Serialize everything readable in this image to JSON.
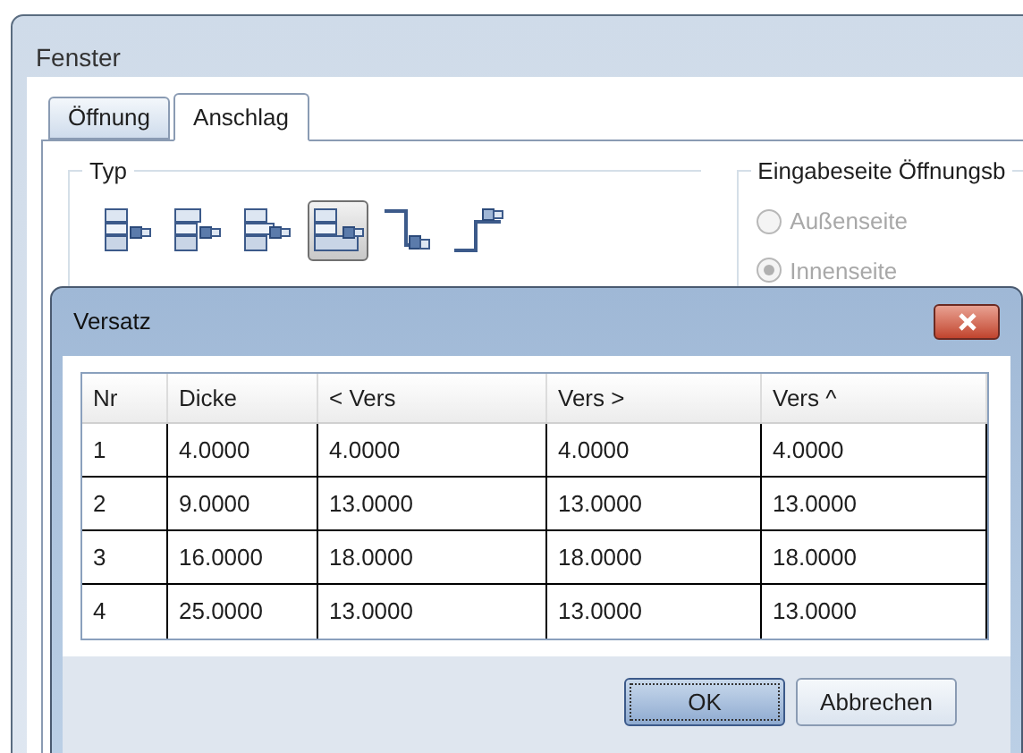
{
  "window": {
    "title": "Fenster"
  },
  "tabs": [
    {
      "label": "Öffnung",
      "selected": false
    },
    {
      "label": "Anschlag",
      "selected": true
    }
  ],
  "type_group": {
    "title": "Typ",
    "options": [
      {
        "selected": false
      },
      {
        "selected": false
      },
      {
        "selected": false
      },
      {
        "selected": true
      },
      {
        "selected": false
      },
      {
        "selected": false
      }
    ]
  },
  "input_side_group": {
    "title": "Eingabeseite Öffnungsb",
    "radios": [
      {
        "label": "Außenseite",
        "selected": false,
        "disabled": true
      },
      {
        "label": "Innenseite",
        "selected": true,
        "disabled": true
      }
    ]
  },
  "dialog": {
    "title": "Versatz",
    "table": {
      "columns": [
        "Nr",
        "Dicke",
        "< Vers",
        "Vers >",
        "Vers ^"
      ],
      "rows": [
        [
          "1",
          "4.0000",
          "4.0000",
          "4.0000",
          "4.0000"
        ],
        [
          "2",
          "9.0000",
          "13.0000",
          "13.0000",
          "13.0000"
        ],
        [
          "3",
          "16.0000",
          "18.0000",
          "18.0000",
          "18.0000"
        ],
        [
          "4",
          "25.0000",
          "13.0000",
          "13.0000",
          "13.0000"
        ]
      ]
    },
    "buttons": [
      {
        "label": "OK",
        "default": true
      },
      {
        "label": "Abbrechen",
        "default": false
      }
    ]
  }
}
